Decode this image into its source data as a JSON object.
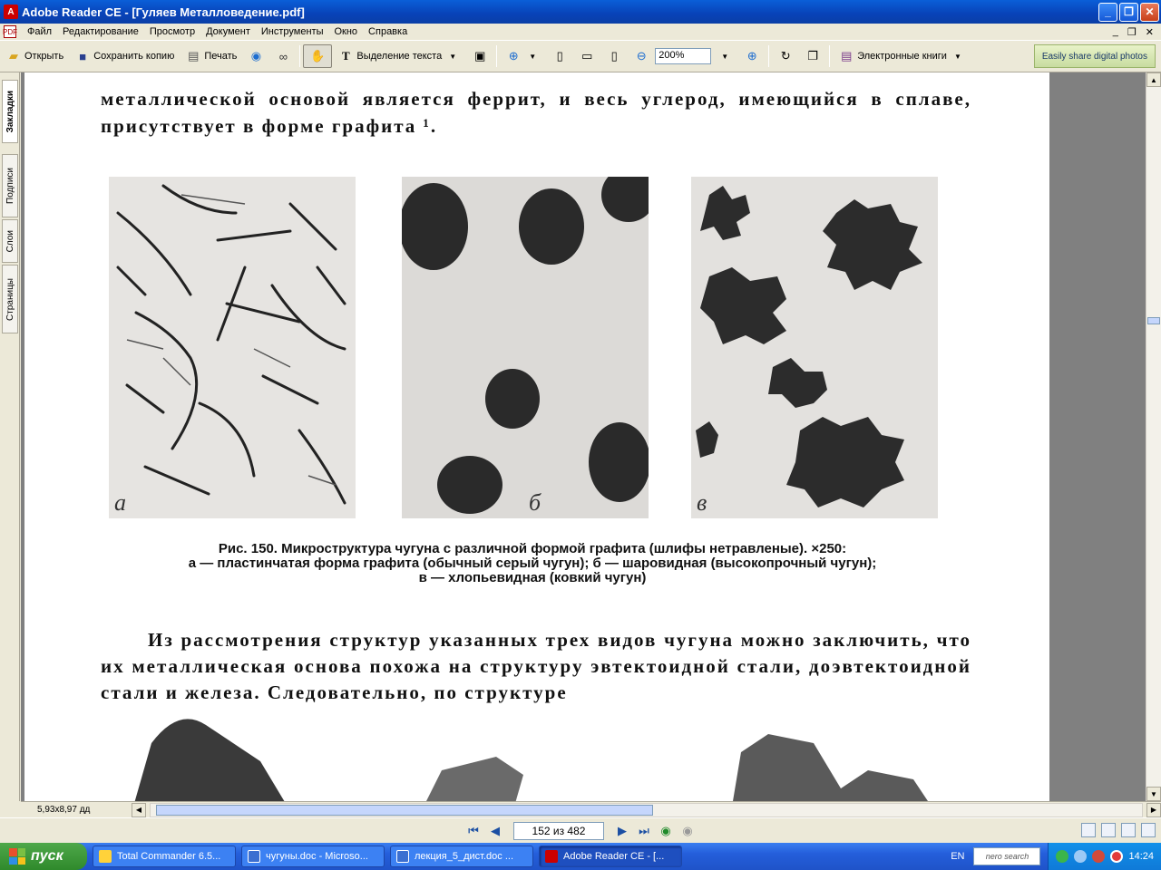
{
  "window": {
    "title": "Adobe Reader CE - [Гуляев Металловедение.pdf]",
    "app_icon": "acrobat-icon",
    "controls": [
      "_",
      "❐",
      "✕"
    ]
  },
  "menu": {
    "items": [
      "Файл",
      "Редактирование",
      "Просмотр",
      "Документ",
      "Инструменты",
      "Окно",
      "Справка"
    ],
    "doc_controls": [
      "_",
      "❐",
      "✕"
    ]
  },
  "toolbar": {
    "open_label": "Открыть",
    "save_copy_label": "Сохранить копию",
    "print_label": "Печать",
    "select_text_label": "Выделение текста",
    "zoom_value": "200%",
    "ebooks_label": "Электронные книги",
    "promo_label": "Easily share digital photos"
  },
  "nav_tabs": [
    "Закладки",
    "Подписи",
    "Слои",
    "Страницы"
  ],
  "page": {
    "para1": "металлической основой является феррит, и весь углерод, имеющийся в сплаве, присутствует в форме графита ¹.",
    "photo_labels": [
      "а",
      "б",
      "в"
    ],
    "caption_line1": "Рис. 150. Микроструктура чугуна с различной формой графита (шлифы нетравленые). ×250:",
    "caption_line2": "а — пластинчатая форма графита (обычный серый чугун); б — шаровидная (высокопрочный чугун);",
    "caption_line3": "в — хлопьевидная (ковкий чугун)",
    "para2": "Из рассмотрения структур указанных трех видов чугуна можно заключить, что их металлическая основа похожа на структуру эвтектоидной стали, доэвтектоидной стали и железа. Следовательно, по структуре"
  },
  "status": {
    "page_size": "5,93x8,97 дд",
    "page_indicator": "152 из 482"
  },
  "taskbar": {
    "start_label": "пуск",
    "tasks": [
      "Total Commander 6.5...",
      "чугуны.doc - Microso...",
      "лекция_5_дист.doc ...",
      "Adobe Reader CE - [..."
    ],
    "lang": "EN",
    "nero_label": "nero search",
    "clock": "14:24"
  }
}
